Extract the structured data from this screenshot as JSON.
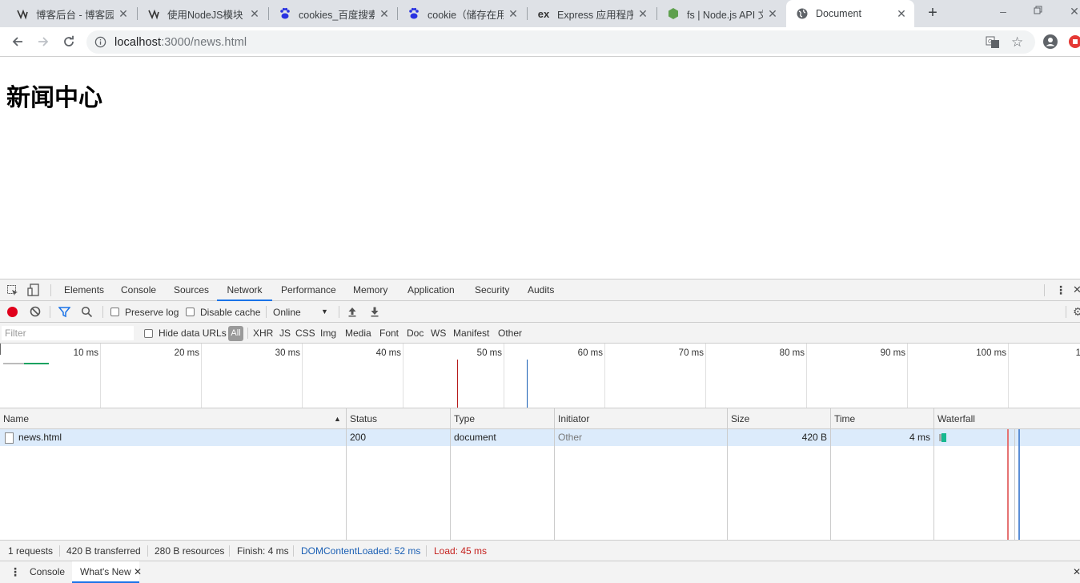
{
  "browser": {
    "tabs": [
      {
        "title": "博客后台 - 博客园",
        "icon": "cnblogs-icon"
      },
      {
        "title": "使用NodeJS模块",
        "icon": "cnblogs-icon"
      },
      {
        "title": "cookies_百度搜索",
        "icon": "baidu-icon"
      },
      {
        "title": "cookie（储存在用",
        "icon": "baidu-icon"
      },
      {
        "title": "Express 应用程序",
        "icon": "express-icon"
      },
      {
        "title": "fs | Node.js API 文",
        "icon": "nodejs-icon"
      },
      {
        "title": "Document",
        "icon": "globe-icon"
      }
    ],
    "active_tab_index": 6,
    "url_host": "localhost",
    "url_path": ":3000/news.html"
  },
  "page": {
    "heading": "新闻中心"
  },
  "devtools": {
    "tabs": [
      "Elements",
      "Console",
      "Sources",
      "Network",
      "Performance",
      "Memory",
      "Application",
      "Security",
      "Audits"
    ],
    "active_tab": "Network",
    "toolbar": {
      "preserve_log": "Preserve log",
      "disable_cache": "Disable cache",
      "throttle": "Online"
    },
    "filter": {
      "placeholder": "Filter",
      "hide_data_urls": "Hide data URLs",
      "types": [
        "All",
        "XHR",
        "JS",
        "CSS",
        "Img",
        "Media",
        "Font",
        "Doc",
        "WS",
        "Manifest",
        "Other"
      ]
    },
    "overview_ticks": [
      "10 ms",
      "20 ms",
      "30 ms",
      "40 ms",
      "50 ms",
      "60 ms",
      "70 ms",
      "80 ms",
      "90 ms",
      "100 ms",
      "1"
    ],
    "columns": [
      "Name",
      "Status",
      "Type",
      "Initiator",
      "Size",
      "Time",
      "Waterfall"
    ],
    "rows": [
      {
        "name": "news.html",
        "status": "200",
        "type": "document",
        "initiator": "Other",
        "size": "420 B",
        "time": "4 ms"
      }
    ],
    "summary": {
      "requests": "1 requests",
      "transferred": "420 B transferred",
      "resources": "280 B resources",
      "finish": "Finish: 4 ms",
      "dom_loaded": "DOMContentLoaded: 52 ms",
      "load": "Load: 45 ms"
    },
    "drawer_tabs": [
      "Console",
      "What's New"
    ],
    "colors": {
      "accent": "#1a73e8",
      "dom_loaded": "#1a5fb4",
      "load": "#c5221f",
      "record": "#e0001b"
    }
  }
}
